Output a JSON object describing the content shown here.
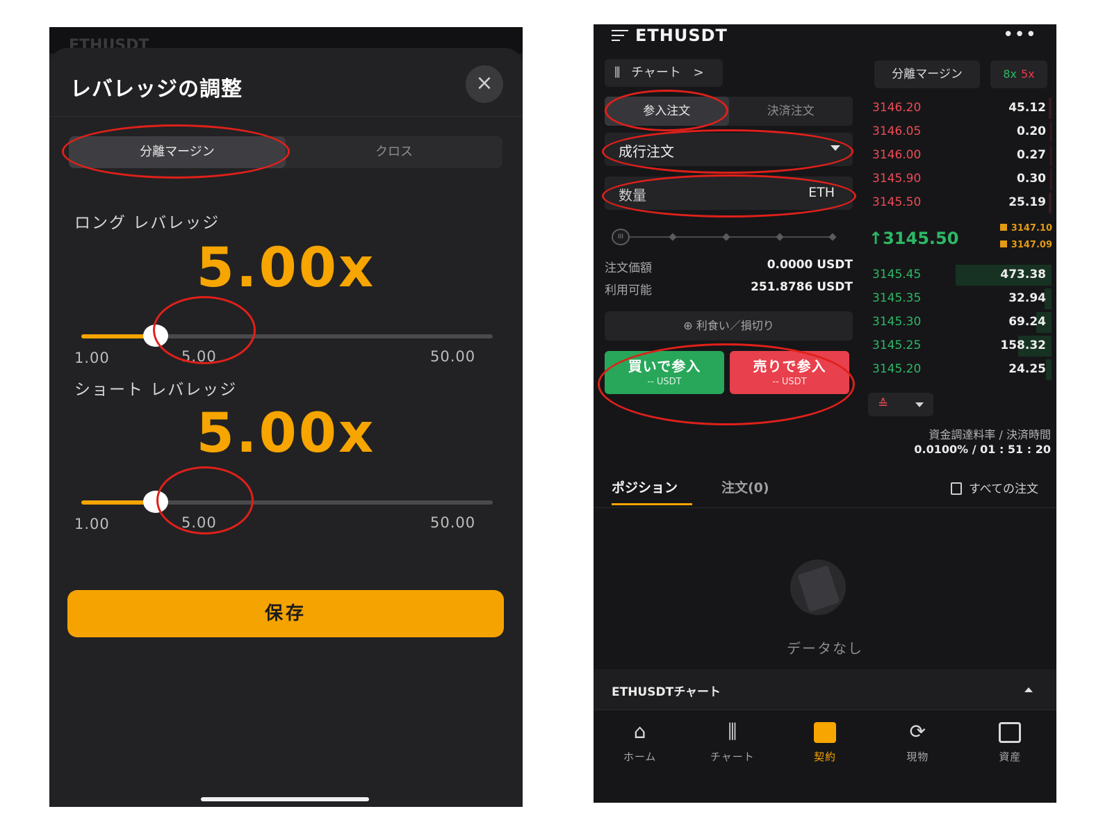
{
  "leverage_modal": {
    "behind_title": "ETHUSDT",
    "title": "レバレッジの調整",
    "close_icon": "×",
    "margin_modes": [
      "分離マージン",
      "クロス"
    ],
    "selected_margin_mode": "分離マージン",
    "long": {
      "label": "ロング レバレッジ",
      "value": "5.00x",
      "min_label": "1.00",
      "current_label": "5.00",
      "max_label": "50.00",
      "min": 1,
      "max": 50,
      "current": 5
    },
    "short": {
      "label": "ショート レバレッジ",
      "value": "5.00x",
      "min_label": "1.00",
      "current_label": "5.00",
      "max_label": "50.00",
      "min": 1,
      "max": 50,
      "current": 5
    },
    "save_label": "保存"
  },
  "trading": {
    "pair": "ETHUSDT",
    "more_icon": "•••",
    "chart_chip_label": "チャート",
    "chart_chip_arrow": ">",
    "margin_mode": "分離マージン",
    "leverage_long": "8x",
    "leverage_short": "5x",
    "order_tabs": [
      "参入注文",
      "決済注文"
    ],
    "order_type": "成行注文",
    "quantity_placeholder": "数量",
    "quantity_unit": "ETH",
    "slider_handle_icon": "III",
    "order_value_label": "注文価額",
    "order_value": "0.0000 USDT",
    "available_label": "利用可能",
    "available": "251.8786 USDT",
    "tpsl_label": "⊕ 利食い／損切り",
    "buy": {
      "label": "買いで参入",
      "sub": "-- USDT"
    },
    "sell": {
      "label": "売りで参入",
      "sub": "-- USDT"
    },
    "asks": [
      {
        "price": "3146.20",
        "qty": "45.12"
      },
      {
        "price": "3146.05",
        "qty": "0.20"
      },
      {
        "price": "3146.00",
        "qty": "0.27"
      },
      {
        "price": "3145.90",
        "qty": "0.30"
      },
      {
        "price": "3145.50",
        "qty": "25.19"
      }
    ],
    "last_price": "↑3145.50",
    "mark_price_1": "3147.10",
    "mark_price_2": "3147.09",
    "bids": [
      {
        "price": "3145.45",
        "qty": "473.38"
      },
      {
        "price": "3145.35",
        "qty": "32.94"
      },
      {
        "price": "3145.30",
        "qty": "69.24"
      },
      {
        "price": "3145.25",
        "qty": "158.32"
      },
      {
        "price": "3145.20",
        "qty": "24.25"
      }
    ],
    "depth_icon": "≙",
    "funding_label": "資金調達料率 / 決済時間",
    "funding_value": "0.0100% / 01 : 51 : 20",
    "position_tabs": [
      "ポジション",
      "注文(0)"
    ],
    "all_orders_label": "すべての注文",
    "empty_text": "データなし",
    "chart_bar_label": "ETHUSDTチャート",
    "nav": [
      {
        "label": "ホーム",
        "icon": "home-icon"
      },
      {
        "label": "チャート",
        "icon": "candlestick-icon"
      },
      {
        "label": "契約",
        "icon": "contract-icon"
      },
      {
        "label": "現物",
        "icon": "spot-icon"
      },
      {
        "label": "資産",
        "icon": "wallet-icon"
      }
    ],
    "active_nav": "契約"
  },
  "colors": {
    "accent": "#f7a500",
    "buy": "#28a75a",
    "sell": "#e8404c",
    "annotation": "#e0201a"
  }
}
